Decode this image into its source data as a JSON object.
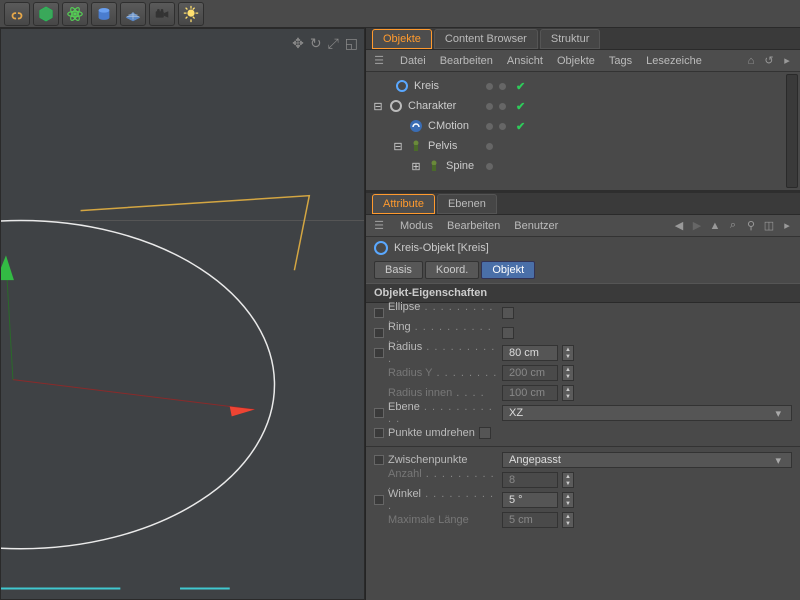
{
  "toolbar_icons": [
    "link-icon",
    "cube-icon",
    "atom-icon",
    "cylinder-icon",
    "grid-icon",
    "camera-icon",
    "light-icon"
  ],
  "viewport_controls": [
    "✥",
    "↻",
    "⤢",
    "◱"
  ],
  "panels": {
    "objects": {
      "tabs": [
        "Objekte",
        "Content Browser",
        "Struktur"
      ],
      "active_tab": "Objekte",
      "menu": [
        "Datei",
        "Bearbeiten",
        "Ansicht",
        "Objekte",
        "Tags",
        "Lesezeiche"
      ],
      "tree": [
        {
          "indent": 0,
          "exp": "",
          "icon": "circle-blue",
          "label": "Kreis",
          "dots": 2,
          "check": true
        },
        {
          "indent": 0,
          "exp": "⊟",
          "icon": "circle-grey",
          "label": "Charakter",
          "dots": 2,
          "check": true
        },
        {
          "indent": 1,
          "exp": "",
          "icon": "gear-blue",
          "label": "CMotion",
          "dots": 2,
          "check": true
        },
        {
          "indent": 1,
          "exp": "⊟",
          "icon": "joint-green",
          "label": "Pelvis",
          "dots": 1,
          "check": false
        },
        {
          "indent": 2,
          "exp": "⊞",
          "icon": "joint-green",
          "label": "Spine",
          "dots": 1,
          "check": false
        }
      ]
    },
    "attributes": {
      "tabs": [
        "Attribute",
        "Ebenen"
      ],
      "active_tab": "Attribute",
      "menu": [
        "Modus",
        "Bearbeiten",
        "Benutzer"
      ],
      "object_title": "Kreis-Objekt [Kreis]",
      "mini_tabs": [
        "Basis",
        "Koord.",
        "Objekt"
      ],
      "active_mini": "Objekt",
      "section_title": "Objekt-Eigenschaften",
      "props": {
        "ellipse": "Ellipse",
        "ring": "Ring",
        "radius_lbl": "Radius",
        "radius_val": "80 cm",
        "radiusy_lbl": "Radius Y",
        "radiusy_val": "200 cm",
        "radiusi_lbl": "Radius innen",
        "radiusi_val": "100 cm",
        "ebene_lbl": "Ebene",
        "ebene_val": "XZ",
        "punkte_lbl": "Punkte umdrehen",
        "zp_lbl": "Zwischenpunkte",
        "zp_val": "Angepasst",
        "anzahl_lbl": "Anzahl",
        "anzahl_val": "8",
        "winkel_lbl": "Winkel",
        "winkel_val": "5 °",
        "maxl_lbl": "Maximale Länge",
        "maxl_val": "5 cm"
      }
    }
  }
}
